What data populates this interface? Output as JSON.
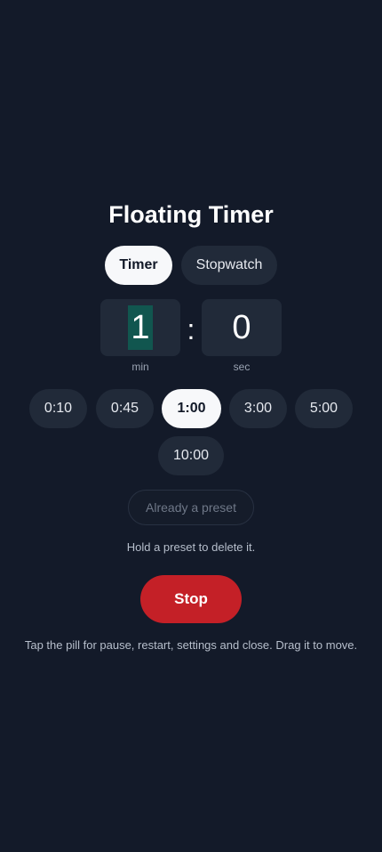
{
  "app": {
    "title": "Floating Timer"
  },
  "mode_tabs": [
    {
      "label": "Timer",
      "active": true
    },
    {
      "label": "Stopwatch",
      "active": false
    }
  ],
  "time_input": {
    "minutes": "1",
    "separator": ":",
    "seconds": "0",
    "min_label": "min",
    "sec_label": "sec"
  },
  "presets": [
    {
      "label": "0:10",
      "selected": false
    },
    {
      "label": "0:45",
      "selected": false
    },
    {
      "label": "1:00",
      "selected": true
    },
    {
      "label": "3:00",
      "selected": false
    },
    {
      "label": "5:00",
      "selected": false
    },
    {
      "label": "10:00",
      "selected": false
    }
  ],
  "add_preset": {
    "label": "Already a preset"
  },
  "hints": {
    "delete_preset": "Hold a preset to delete it.",
    "pill_help": "Tap the pill for pause, restart, settings and close. Drag it to move."
  },
  "actions": {
    "stop_label": "Stop"
  },
  "colors": {
    "background": "#131a29",
    "surface": "#212a39",
    "selected": "#f7f8fa",
    "stop": "#c42027",
    "cursor_highlight": "#11564f"
  }
}
